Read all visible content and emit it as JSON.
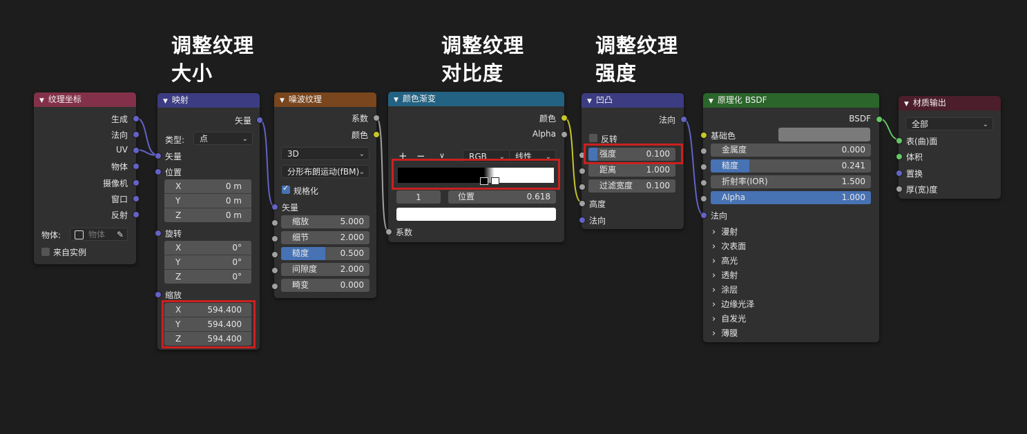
{
  "annotations": {
    "scale_line1": "调整纹理",
    "scale_line2": "大小",
    "contrast_line1": "调整纹理",
    "contrast_line2": "对比度",
    "strength_line1": "调整纹理",
    "strength_line2": "强度"
  },
  "colors": {
    "texcoord_header": "#83314a",
    "mapping_header": "#3c3c83",
    "noise_header": "#79461d",
    "ramp_header": "#246283",
    "bump_header": "#3c3c83",
    "bsdf_header": "#2b652b",
    "output_header": "#4c1d2b",
    "vector_socket": "#6363c7",
    "gray_socket": "#a1a1a1",
    "yellow_socket": "#c7c729",
    "green_socket": "#63c763",
    "highlight_box": "#cc2020",
    "accent_blue": "#4772b3"
  },
  "texcoord": {
    "title": "纹理坐标",
    "outputs": [
      "生成",
      "法向",
      "UV",
      "物体",
      "摄像机",
      "窗口",
      "反射"
    ],
    "object_label": "物体:",
    "object_placeholder": "物体",
    "from_instancer": "来自实例"
  },
  "mapping": {
    "title": "映射",
    "output": "矢量",
    "type_label": "类型:",
    "type_value": "点",
    "vector_input": "矢量",
    "location_label": "位置",
    "location": [
      {
        "k": "X",
        "v": "0 m"
      },
      {
        "k": "Y",
        "v": "0 m"
      },
      {
        "k": "Z",
        "v": "0 m"
      }
    ],
    "rotation_label": "旋转",
    "rotation": [
      {
        "k": "X",
        "v": "0°"
      },
      {
        "k": "Y",
        "v": "0°"
      },
      {
        "k": "Z",
        "v": "0°"
      }
    ],
    "scale_label": "缩放",
    "scale": [
      {
        "k": "X",
        "v": "594.400"
      },
      {
        "k": "Y",
        "v": "594.400"
      },
      {
        "k": "Z",
        "v": "594.400"
      }
    ]
  },
  "noise": {
    "title": "噪波纹理",
    "out_fac": "系数",
    "out_color": "颜色",
    "dimension": "3D",
    "type": "分形布朗运动(fBM)",
    "normalize": "规格化",
    "vector_input": "矢量",
    "fields": [
      {
        "label": "缩放",
        "value": "5.000",
        "fill": 0
      },
      {
        "label": "细节",
        "value": "2.000",
        "fill": 0
      },
      {
        "label": "糙度",
        "value": "0.500",
        "fill": 0.5
      },
      {
        "label": "间隙度",
        "value": "2.000",
        "fill": 0
      },
      {
        "label": "畸变",
        "value": "0.000",
        "fill": 0
      }
    ]
  },
  "ramp": {
    "title": "颜色渐变",
    "out_color": "颜色",
    "out_alpha": "Alpha",
    "add": "+",
    "remove": "−",
    "more": "∨",
    "color_mode": "RGB",
    "interpolation": "线性",
    "stop_index": "1",
    "pos_label": "位置",
    "pos_value": "0.618",
    "stops": [
      0.55,
      0.618
    ],
    "fac_input": "系数"
  },
  "bump": {
    "title": "凹凸",
    "out_normal": "法向",
    "invert": "反转",
    "fields": [
      {
        "label": "强度",
        "value": "0.100",
        "fill": 0.1
      },
      {
        "label": "距离",
        "value": "1.000",
        "fill": 0
      },
      {
        "label": "过滤宽度",
        "value": "0.100",
        "fill": 0
      }
    ],
    "height": "高度",
    "normal": "法向"
  },
  "bsdf": {
    "title": "原理化 BSDF",
    "out": "BSDF",
    "base_color": "基础色",
    "fields": [
      {
        "label": "金属度",
        "value": "0.000",
        "fill": 0
      },
      {
        "label": "糙度",
        "value": "0.241",
        "fill": 0.241
      },
      {
        "label": "折射率(IOR)",
        "value": "1.500",
        "fill": 0
      },
      {
        "label": "Alpha",
        "value": "1.000",
        "fill": 1
      }
    ],
    "normal": "法向",
    "panels": [
      "漫射",
      "次表面",
      "高光",
      "透射",
      "涂层",
      "边缘光泽",
      "自发光",
      "薄膜"
    ]
  },
  "output": {
    "title": "材质输出",
    "target": "全部",
    "inputs": [
      "表(曲)面",
      "体积",
      "置换",
      "厚(宽)度"
    ]
  }
}
